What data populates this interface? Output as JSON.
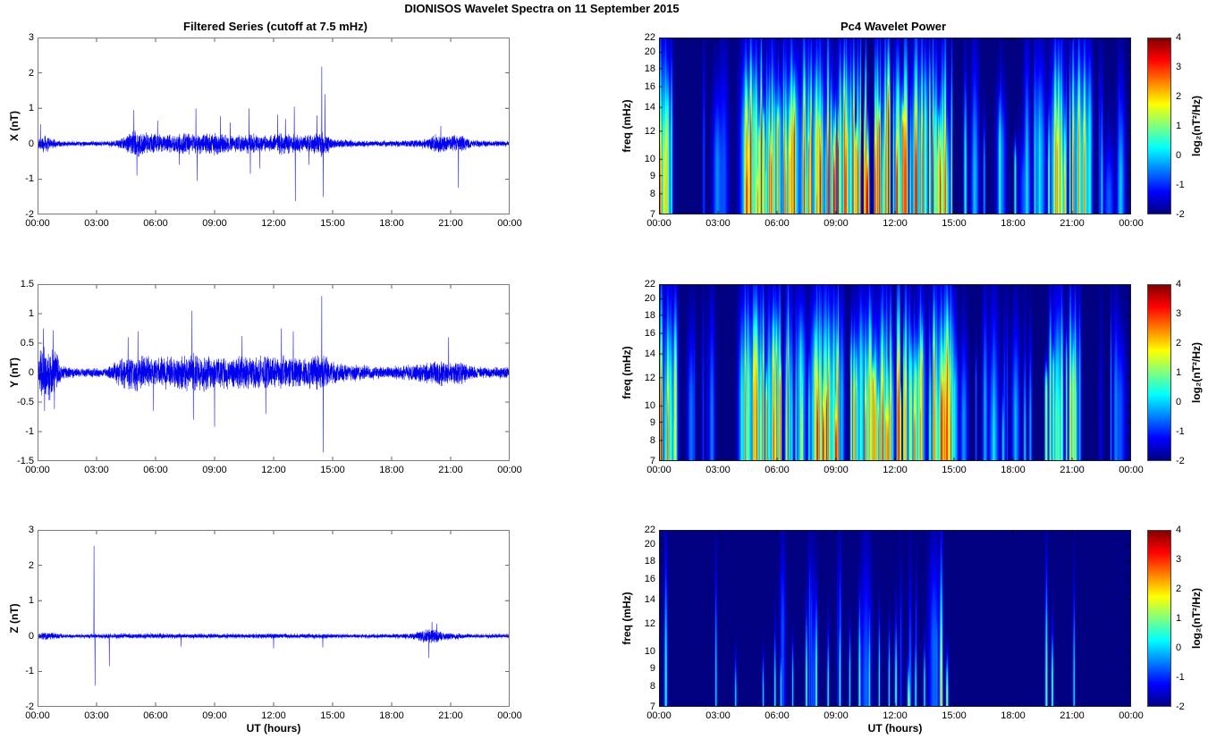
{
  "figure": {
    "title": "DIONISOS Wavelet Spectra on 11 September 2015"
  },
  "left_column": {
    "title": "Filtered Series (cutoff at 7.5 mHz)",
    "xlabel": "UT (hours)",
    "x_ticks": [
      "00:00",
      "03:00",
      "06:00",
      "09:00",
      "12:00",
      "15:00",
      "18:00",
      "21:00",
      "00:00"
    ],
    "panels": [
      {
        "ylabel": "X (nT)",
        "ylim": [
          -2,
          3
        ],
        "y_ticks": [
          3,
          2,
          1,
          0,
          -1,
          -2
        ]
      },
      {
        "ylabel": "Y (nT)",
        "ylim": [
          -1.5,
          1.5
        ],
        "y_ticks": [
          1.5,
          1,
          0.5,
          0,
          -0.5,
          -1,
          -1.5
        ]
      },
      {
        "ylabel": "Z (nT)",
        "ylim": [
          -2,
          3
        ],
        "y_ticks": [
          3,
          2,
          1,
          0,
          -1,
          -2
        ]
      }
    ]
  },
  "right_column": {
    "title": "Pc4 Wavelet Power",
    "xlabel": "UT (hours)",
    "x_ticks": [
      "00:00",
      "03:00",
      "06:00",
      "09:00",
      "12:00",
      "15:00",
      "18:00",
      "21:00",
      "00:00"
    ],
    "ylabel": "freq (mHz)",
    "f_ticks": [
      22,
      20,
      18,
      16,
      14,
      12,
      10,
      9,
      8,
      7
    ],
    "flim": [
      7,
      22
    ],
    "colorbar": {
      "label": "log₂(nT²/Hz)",
      "ticks": [
        4,
        3,
        2,
        1,
        0,
        -1,
        -2
      ],
      "clim": [
        -2,
        4
      ],
      "colormap": "jet"
    }
  },
  "chart_data": [
    {
      "type": "line",
      "panel": "X",
      "ylabel": "X (nT)",
      "ylim": [
        -2,
        3
      ],
      "x_range_hours": [
        0,
        24
      ],
      "color": "#0000ee",
      "seed": 101,
      "envelope": [
        [
          0,
          0.12
        ],
        [
          0.3,
          0.3
        ],
        [
          0.8,
          0.15
        ],
        [
          1.5,
          0.06
        ],
        [
          3.5,
          0.06
        ],
        [
          4.2,
          0.15
        ],
        [
          5,
          0.45
        ],
        [
          5.5,
          0.35
        ],
        [
          6,
          0.3
        ],
        [
          6.5,
          0.25
        ],
        [
          7,
          0.3
        ],
        [
          7.5,
          0.35
        ],
        [
          8,
          0.3
        ],
        [
          9,
          0.35
        ],
        [
          9.5,
          0.3
        ],
        [
          10,
          0.25
        ],
        [
          10.5,
          0.3
        ],
        [
          11,
          0.3
        ],
        [
          11.5,
          0.25
        ],
        [
          12,
          0.3
        ],
        [
          12.5,
          0.35
        ],
        [
          13,
          0.3
        ],
        [
          13.5,
          0.25
        ],
        [
          14,
          0.3
        ],
        [
          14.5,
          0.4
        ],
        [
          15,
          0.15
        ],
        [
          16,
          0.1
        ],
        [
          17,
          0.08
        ],
        [
          18,
          0.08
        ],
        [
          19,
          0.1
        ],
        [
          19.8,
          0.15
        ],
        [
          20.3,
          0.3
        ],
        [
          21,
          0.25
        ],
        [
          21.5,
          0.3
        ],
        [
          22,
          0.12
        ],
        [
          23,
          0.08
        ],
        [
          24,
          0.08
        ]
      ],
      "spikes": [
        [
          0.15,
          0.55
        ],
        [
          4.9,
          0.95
        ],
        [
          5.05,
          -0.9
        ],
        [
          6.1,
          0.65
        ],
        [
          7.2,
          -0.6
        ],
        [
          8.05,
          1.0
        ],
        [
          8.12,
          -1.05
        ],
        [
          9.3,
          0.78
        ],
        [
          9.8,
          0.6
        ],
        [
          10.75,
          1.0
        ],
        [
          10.82,
          -0.85
        ],
        [
          11.3,
          -0.7
        ],
        [
          12.2,
          0.82
        ],
        [
          12.6,
          0.7
        ],
        [
          13.05,
          1.05
        ],
        [
          13.1,
          -1.62
        ],
        [
          13.8,
          -0.6
        ],
        [
          14.2,
          0.8
        ],
        [
          14.45,
          2.18
        ],
        [
          14.52,
          -1.5
        ],
        [
          14.62,
          1.4
        ],
        [
          20.5,
          0.5
        ],
        [
          21.4,
          -1.25
        ]
      ]
    },
    {
      "type": "heatmap",
      "panel": "X wavelet",
      "flim": [
        7,
        22
      ],
      "clim": [
        -2,
        4
      ],
      "background_level": -2,
      "colormap": "jet",
      "seed": 11,
      "windows": [
        {
          "from": 0.02,
          "to": 0.75,
          "count": 10,
          "p": [
            0.3,
            3.2
          ]
        },
        {
          "from": 2.2,
          "to": 3.9,
          "count": 4,
          "p": [
            -1.2,
            -0.3
          ]
        },
        {
          "from": 4.2,
          "to": 6.8,
          "count": 42,
          "p": [
            0.2,
            3.8
          ]
        },
        {
          "from": 6.8,
          "to": 15.2,
          "count": 95,
          "p": [
            0.2,
            4.0
          ]
        },
        {
          "from": 15.4,
          "to": 19.4,
          "count": 16,
          "p": [
            -1.0,
            0.8
          ]
        },
        {
          "from": 19.6,
          "to": 21.9,
          "count": 22,
          "p": [
            0.0,
            3.0
          ]
        },
        {
          "from": 22.2,
          "to": 23.8,
          "count": 6,
          "p": [
            -1.0,
            0.3
          ]
        }
      ],
      "streaks": [
        [
          0.08,
          0.05,
          3.0,
          7.5,
          22
        ],
        [
          5.2,
          0.035,
          3.8,
          10,
          22
        ],
        [
          5.6,
          0.03,
          3.4,
          9,
          18
        ],
        [
          8.2,
          0.04,
          3.9,
          8,
          16
        ],
        [
          8.9,
          0.05,
          4.0,
          8,
          14
        ],
        [
          9.5,
          0.04,
          3.6,
          8,
          18
        ],
        [
          10.6,
          0.06,
          4.0,
          7.5,
          13
        ],
        [
          11.0,
          0.04,
          3.5,
          8,
          20
        ],
        [
          12.1,
          0.05,
          3.8,
          8,
          16
        ],
        [
          12.5,
          0.04,
          3.6,
          9,
          22
        ],
        [
          13.1,
          0.045,
          4.0,
          8,
          22
        ],
        [
          14.3,
          0.05,
          3.8,
          8,
          15
        ],
        [
          14.55,
          0.04,
          3.5,
          8,
          22
        ],
        [
          21.05,
          0.035,
          3.2,
          9,
          22
        ]
      ]
    },
    {
      "type": "line",
      "panel": "Y",
      "ylabel": "Y (nT)",
      "ylim": [
        -1.5,
        1.5
      ],
      "x_range_hours": [
        0,
        24
      ],
      "color": "#0000ee",
      "seed": 102,
      "envelope": [
        [
          0,
          0.1
        ],
        [
          0.2,
          0.55
        ],
        [
          0.5,
          0.5
        ],
        [
          0.9,
          0.45
        ],
        [
          1.2,
          0.15
        ],
        [
          2,
          0.08
        ],
        [
          3.5,
          0.08
        ],
        [
          4,
          0.2
        ],
        [
          4.5,
          0.3
        ],
        [
          5,
          0.35
        ],
        [
          5.5,
          0.3
        ],
        [
          6,
          0.25
        ],
        [
          6.5,
          0.3
        ],
        [
          7,
          0.3
        ],
        [
          8,
          0.35
        ],
        [
          9,
          0.3
        ],
        [
          10,
          0.3
        ],
        [
          11,
          0.3
        ],
        [
          12,
          0.3
        ],
        [
          13,
          0.3
        ],
        [
          14,
          0.3
        ],
        [
          14.6,
          0.35
        ],
        [
          15,
          0.2
        ],
        [
          16,
          0.15
        ],
        [
          17,
          0.12
        ],
        [
          18,
          0.12
        ],
        [
          19,
          0.15
        ],
        [
          20,
          0.2
        ],
        [
          20.5,
          0.25
        ],
        [
          21,
          0.2
        ],
        [
          21.5,
          0.25
        ],
        [
          22,
          0.12
        ],
        [
          23,
          0.1
        ],
        [
          24,
          0.1
        ]
      ],
      "spikes": [
        [
          0.3,
          0.75
        ],
        [
          0.36,
          -0.65
        ],
        [
          0.8,
          0.72
        ],
        [
          0.86,
          -0.62
        ],
        [
          4.6,
          0.6
        ],
        [
          5.1,
          0.7
        ],
        [
          5.9,
          -0.65
        ],
        [
          7.85,
          1.05
        ],
        [
          7.92,
          -0.8
        ],
        [
          9.0,
          -0.92
        ],
        [
          10.4,
          0.62
        ],
        [
          11.6,
          -0.7
        ],
        [
          12.4,
          0.75
        ],
        [
          13.0,
          0.7
        ],
        [
          14.45,
          1.3
        ],
        [
          14.52,
          -1.35
        ],
        [
          20.9,
          0.6
        ]
      ]
    },
    {
      "type": "heatmap",
      "panel": "Y wavelet",
      "flim": [
        7,
        22
      ],
      "clim": [
        -2,
        4
      ],
      "background_level": -2,
      "colormap": "jet",
      "seed": 22,
      "windows": [
        {
          "from": 0.05,
          "to": 0.95,
          "count": 12,
          "p": [
            0.5,
            2.8
          ]
        },
        {
          "from": 1.5,
          "to": 3.9,
          "count": 5,
          "p": [
            -1.3,
            -0.4
          ]
        },
        {
          "from": 4.2,
          "to": 6.8,
          "count": 38,
          "p": [
            0.2,
            3.2
          ]
        },
        {
          "from": 6.8,
          "to": 15.2,
          "count": 90,
          "p": [
            0.2,
            3.6
          ]
        },
        {
          "from": 15.4,
          "to": 19.4,
          "count": 14,
          "p": [
            -1.0,
            0.6
          ]
        },
        {
          "from": 19.6,
          "to": 21.6,
          "count": 16,
          "p": [
            -0.3,
            2.2
          ]
        },
        {
          "from": 22.2,
          "to": 23.8,
          "count": 5,
          "p": [
            -1.2,
            0.0
          ]
        }
      ],
      "streaks": [
        [
          0.12,
          0.05,
          3.9,
          7.5,
          22
        ],
        [
          0.45,
          0.05,
          3.0,
          8,
          20
        ],
        [
          5.85,
          0.04,
          3.3,
          8,
          16
        ],
        [
          8.05,
          0.05,
          3.8,
          8,
          16
        ],
        [
          8.35,
          0.04,
          3.5,
          8,
          13
        ],
        [
          9.0,
          0.05,
          3.7,
          7.5,
          12
        ],
        [
          10.5,
          0.04,
          3.2,
          8,
          18
        ],
        [
          12.2,
          0.05,
          3.9,
          8,
          22
        ],
        [
          13.0,
          0.04,
          3.3,
          8,
          14
        ],
        [
          14.35,
          0.05,
          3.7,
          8,
          20
        ],
        [
          14.6,
          0.04,
          3.2,
          8,
          22
        ]
      ]
    },
    {
      "type": "line",
      "panel": "Z",
      "ylabel": "Z (nT)",
      "ylim": [
        -2,
        3
      ],
      "x_range_hours": [
        0,
        24
      ],
      "color": "#0000ee",
      "seed": 103,
      "envelope": [
        [
          0,
          0.06
        ],
        [
          0.3,
          0.12
        ],
        [
          0.8,
          0.1
        ],
        [
          1.5,
          0.04
        ],
        [
          2.5,
          0.04
        ],
        [
          3,
          0.05
        ],
        [
          4,
          0.06
        ],
        [
          5,
          0.06
        ],
        [
          6,
          0.07
        ],
        [
          7,
          0.05
        ],
        [
          8,
          0.06
        ],
        [
          9,
          0.05
        ],
        [
          10,
          0.05
        ],
        [
          11,
          0.06
        ],
        [
          12,
          0.07
        ],
        [
          13,
          0.05
        ],
        [
          14,
          0.06
        ],
        [
          15,
          0.05
        ],
        [
          16,
          0.04
        ],
        [
          17,
          0.04
        ],
        [
          18,
          0.05
        ],
        [
          19,
          0.08
        ],
        [
          19.7,
          0.2
        ],
        [
          20.2,
          0.25
        ],
        [
          20.6,
          0.15
        ],
        [
          21,
          0.1
        ],
        [
          21.5,
          0.08
        ],
        [
          22,
          0.05
        ],
        [
          23,
          0.04
        ],
        [
          24,
          0.04
        ]
      ],
      "spikes": [
        [
          2.87,
          2.55
        ],
        [
          2.92,
          -1.4
        ],
        [
          3.65,
          -0.85
        ],
        [
          7.3,
          -0.3
        ],
        [
          12.0,
          -0.35
        ],
        [
          14.5,
          -0.32
        ],
        [
          19.9,
          -0.62
        ],
        [
          20.05,
          0.4
        ],
        [
          20.3,
          0.35
        ]
      ]
    },
    {
      "type": "heatmap",
      "panel": "Z wavelet",
      "flim": [
        7,
        22
      ],
      "clim": [
        -2,
        4
      ],
      "background_level": -2,
      "colormap": "jet",
      "seed": 33,
      "windows": [
        {
          "from": 5.0,
          "to": 15.0,
          "count": 12,
          "p": [
            -1.4,
            -0.4
          ]
        }
      ],
      "streaks": [
        [
          0.35,
          0.05,
          0.6,
          8,
          20
        ],
        [
          2.9,
          0.03,
          0.4,
          8,
          18
        ],
        [
          3.9,
          0.03,
          0.4,
          7.5,
          10
        ],
        [
          5.3,
          0.03,
          0.5,
          7.5,
          10
        ],
        [
          5.9,
          0.03,
          0.8,
          7.5,
          12
        ],
        [
          6.2,
          0.03,
          0.5,
          8,
          10
        ],
        [
          6.8,
          0.03,
          0.5,
          8,
          11
        ],
        [
          7.5,
          0.035,
          0.9,
          8,
          14
        ],
        [
          8.0,
          0.04,
          1.1,
          8,
          15
        ],
        [
          8.6,
          0.03,
          0.8,
          7.5,
          12
        ],
        [
          9.2,
          0.035,
          1.0,
          8,
          14
        ],
        [
          9.7,
          0.03,
          0.7,
          8,
          12
        ],
        [
          10.2,
          0.04,
          1.0,
          8,
          15
        ],
        [
          10.7,
          0.035,
          0.9,
          8,
          14
        ],
        [
          11.2,
          0.03,
          0.8,
          8,
          13
        ],
        [
          11.7,
          0.03,
          0.7,
          8,
          12
        ],
        [
          12.05,
          0.04,
          0.9,
          7.5,
          13
        ],
        [
          12.7,
          0.05,
          1.6,
          7,
          9.5
        ],
        [
          13.05,
          0.03,
          0.8,
          7.5,
          12
        ],
        [
          13.5,
          0.03,
          0.6,
          8,
          11
        ],
        [
          14.35,
          0.05,
          2.2,
          7,
          20
        ],
        [
          14.65,
          0.04,
          1.5,
          7.5,
          10
        ],
        [
          19.7,
          0.04,
          1.2,
          8,
          18
        ],
        [
          20.0,
          0.035,
          1.0,
          8,
          12
        ],
        [
          21.1,
          0.03,
          0.5,
          8,
          16
        ]
      ]
    }
  ]
}
